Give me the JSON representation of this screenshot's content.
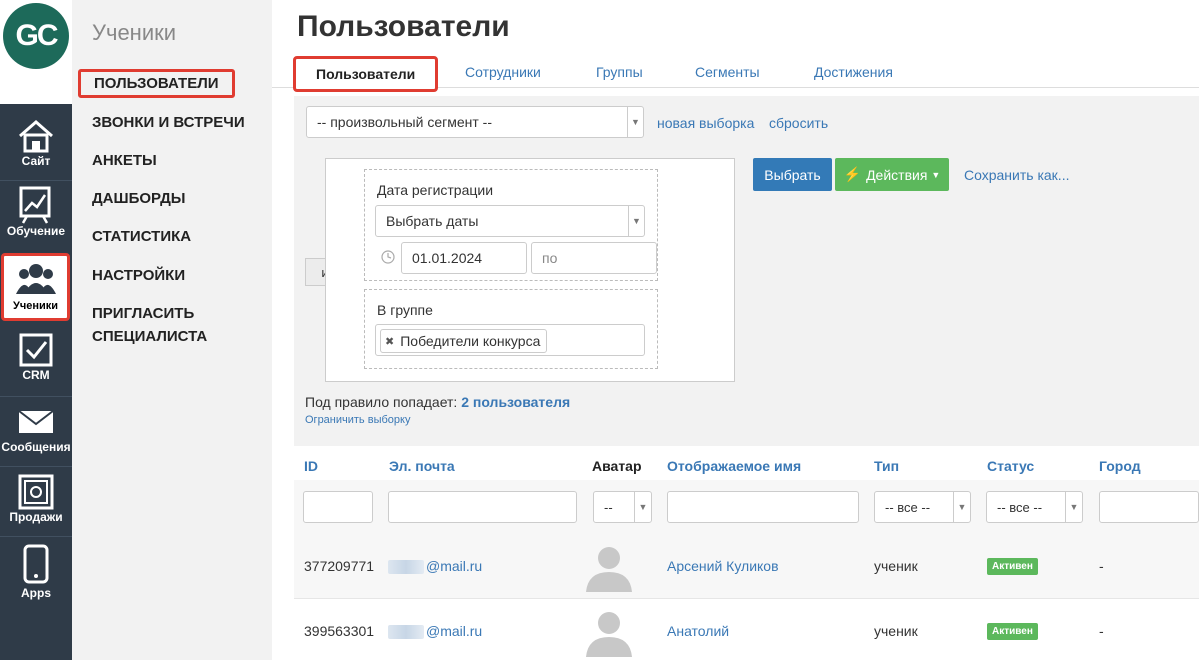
{
  "logo": {
    "text": "GC"
  },
  "iconbar": {
    "items": [
      {
        "label": "Сайт",
        "icon": "home-icon"
      },
      {
        "label": "Обучение",
        "icon": "chart-board-icon"
      },
      {
        "label": "Ученики",
        "icon": "users-icon"
      },
      {
        "label": "CRM",
        "icon": "checkbox-icon"
      },
      {
        "label": "Сообщения",
        "icon": "envelope-icon"
      },
      {
        "label": "Продажи",
        "icon": "safe-icon"
      },
      {
        "label": "Apps",
        "icon": "phone-icon"
      }
    ]
  },
  "sidebar": {
    "title": "Ученики",
    "items": [
      {
        "label": "ПОЛЬЗОВАТЕЛИ"
      },
      {
        "label": "ЗВОНКИ И ВСТРЕЧИ"
      },
      {
        "label": "АНКЕТЫ"
      },
      {
        "label": "ДАШБОРДЫ"
      },
      {
        "label": "СТАТИСТИКА"
      },
      {
        "label": "НАСТРОЙКИ"
      },
      {
        "label": "ПРИГЛАСИТЬ"
      },
      {
        "label": "СПЕЦИАЛИСТА"
      }
    ]
  },
  "page": {
    "title": "Пользователи"
  },
  "tabs": [
    "Пользователи",
    "Сотрудники",
    "Группы",
    "Сегменты",
    "Достижения"
  ],
  "filter": {
    "segment_select": "-- произвольный сегмент --",
    "new_selection": "новая выборка",
    "reset": "сбросить",
    "and_label": "и",
    "conditions": {
      "reg_date_label": "Дата регистрации",
      "reg_date_select": "Выбрать даты",
      "date_from": "01.01.2024",
      "date_to_placeholder": "по",
      "group_label": "В группе",
      "group_tag": "Победители конкурса"
    },
    "select_button": "Выбрать",
    "actions_button": "Действия",
    "save_as": "Сохранить как...",
    "matches_prefix": "Под правило попадает:",
    "matches_count": "2 пользователя",
    "limit_link": "Ограничить выборку"
  },
  "table": {
    "columns": [
      "ID",
      "Эл. почта",
      "Аватар",
      "Отображаемое имя",
      "Тип",
      "Статус",
      "Город"
    ],
    "filters": {
      "avatar": "--",
      "type": "-- все --",
      "status": "-- все --"
    },
    "rows": [
      {
        "id": "377209771",
        "email": "@mail.ru",
        "name": "Арсений Куликов",
        "type": "ученик",
        "status": "Активен",
        "city": "-"
      },
      {
        "id": "399563301",
        "email": "@mail.ru",
        "name": "Анатолий",
        "type": "ученик",
        "status": "Активен",
        "city": "-"
      }
    ]
  }
}
